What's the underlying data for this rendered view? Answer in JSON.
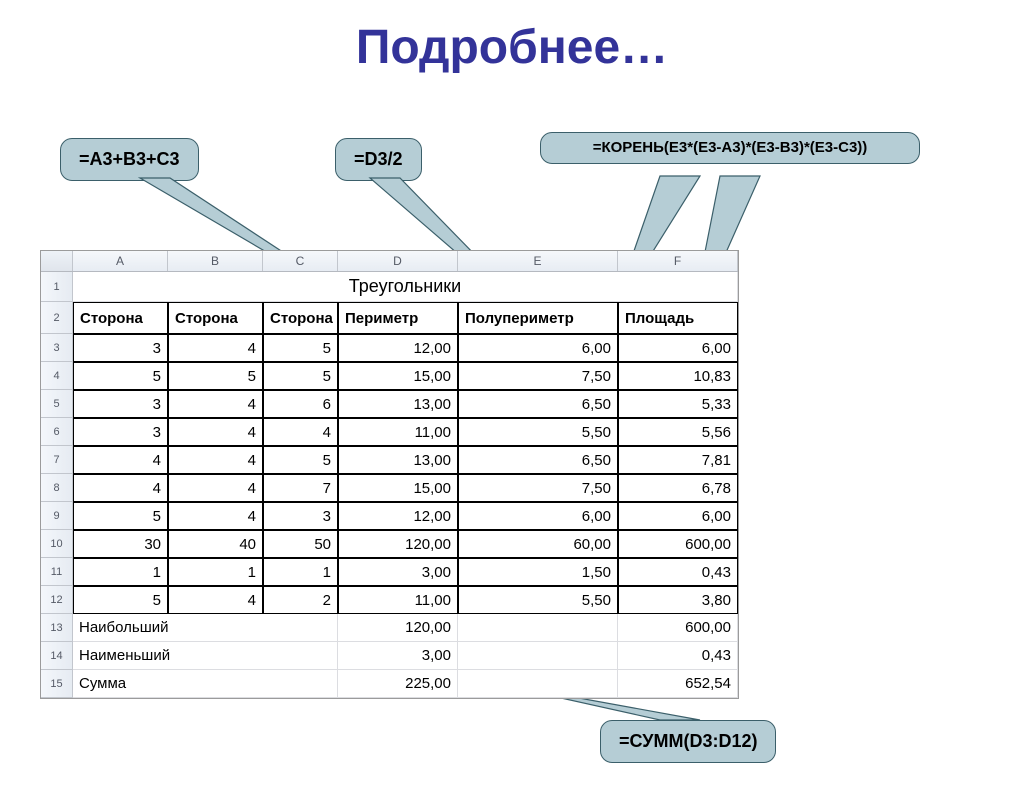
{
  "title": "Подробнее…",
  "callouts": {
    "c1": "=A3+B3+C3",
    "c2": "=D3/2",
    "c3": "=КОРЕНЬ(E3*(E3-A3)*(E3-B3)*(E3-C3))",
    "c4": "=СУММ(D3:D12)"
  },
  "columns": [
    "A",
    "B",
    "C",
    "D",
    "E",
    "F"
  ],
  "sheet_title": "Треугольники",
  "headers": [
    "Сторона",
    "Сторона",
    "Сторона",
    "Периметр",
    "Полупериметр",
    "Площадь"
  ],
  "rows": [
    {
      "n": "3",
      "a": "3",
      "b": "4",
      "c": "5",
      "d": "12,00",
      "e": "6,00",
      "f": "6,00"
    },
    {
      "n": "4",
      "a": "5",
      "b": "5",
      "c": "5",
      "d": "15,00",
      "e": "7,50",
      "f": "10,83"
    },
    {
      "n": "5",
      "a": "3",
      "b": "4",
      "c": "6",
      "d": "13,00",
      "e": "6,50",
      "f": "5,33"
    },
    {
      "n": "6",
      "a": "3",
      "b": "4",
      "c": "4",
      "d": "11,00",
      "e": "5,50",
      "f": "5,56"
    },
    {
      "n": "7",
      "a": "4",
      "b": "4",
      "c": "5",
      "d": "13,00",
      "e": "6,50",
      "f": "7,81"
    },
    {
      "n": "8",
      "a": "4",
      "b": "4",
      "c": "7",
      "d": "15,00",
      "e": "7,50",
      "f": "6,78"
    },
    {
      "n": "9",
      "a": "5",
      "b": "4",
      "c": "3",
      "d": "12,00",
      "e": "6,00",
      "f": "6,00"
    },
    {
      "n": "10",
      "a": "30",
      "b": "40",
      "c": "50",
      "d": "120,00",
      "e": "60,00",
      "f": "600,00"
    },
    {
      "n": "11",
      "a": "1",
      "b": "1",
      "c": "1",
      "d": "3,00",
      "e": "1,50",
      "f": "0,43"
    },
    {
      "n": "12",
      "a": "5",
      "b": "4",
      "c": "2",
      "d": "11,00",
      "e": "5,50",
      "f": "3,80"
    }
  ],
  "summary": [
    {
      "n": "13",
      "label": "Наибольший",
      "d": "120,00",
      "f": "600,00"
    },
    {
      "n": "14",
      "label": "Наименьший",
      "d": "3,00",
      "f": "0,43"
    },
    {
      "n": "15",
      "label": "Сумма",
      "d": "225,00",
      "f": "652,54"
    }
  ]
}
